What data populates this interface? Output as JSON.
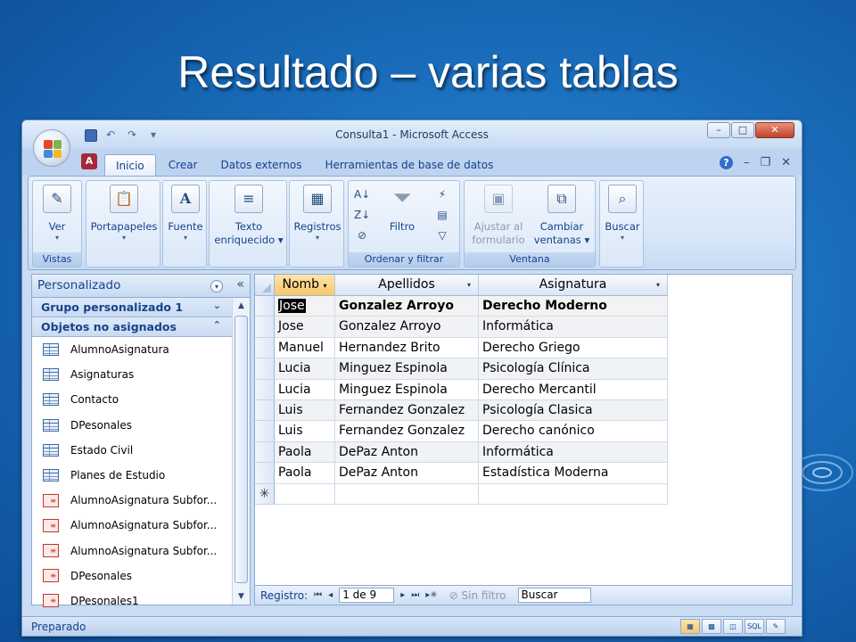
{
  "slide": {
    "title": "Resultado – varias tablas"
  },
  "window": {
    "title": "Consulta1 - Microsoft Access",
    "controls": {
      "minimize": "–",
      "maximize": "□",
      "close": "✕"
    }
  },
  "ribbon": {
    "tabs": [
      "Inicio",
      "Crear",
      "Datos externos",
      "Herramientas de base de datos"
    ],
    "groups": {
      "vistas": {
        "label": "Vistas",
        "ver": "Ver"
      },
      "portapapeles": "Portapapeles",
      "fuente": "Fuente",
      "texto": {
        "line1": "Texto",
        "line2": "enriquecido"
      },
      "registros": "Registros",
      "ordenar": {
        "label": "Ordenar y filtrar",
        "filtro": "Filtro"
      },
      "ventana": {
        "label": "Ventana",
        "ajustar1": "Ajustar al",
        "ajustar2": "formulario",
        "cambiar1": "Cambiar",
        "cambiar2": "ventanas"
      },
      "buscar": "Buscar"
    }
  },
  "nav": {
    "title": "Personalizado",
    "group1": "Grupo personalizado 1",
    "group2": "Objetos no asignados",
    "items": [
      {
        "label": "AlumnoAsignatura",
        "type": "table"
      },
      {
        "label": "Asignaturas",
        "type": "table"
      },
      {
        "label": "Contacto",
        "type": "table"
      },
      {
        "label": "DPesonales",
        "type": "table"
      },
      {
        "label": "Estado Civil",
        "type": "table"
      },
      {
        "label": "Planes de Estudio",
        "type": "table"
      },
      {
        "label": "AlumnoAsignatura Subfor...",
        "type": "form"
      },
      {
        "label": "AlumnoAsignatura Subfor...",
        "type": "form"
      },
      {
        "label": "AlumnoAsignatura Subfor...",
        "type": "form"
      },
      {
        "label": "DPesonales",
        "type": "form"
      },
      {
        "label": "DPesonales1",
        "type": "form"
      }
    ]
  },
  "datasheet": {
    "columns": [
      "Nomb",
      "Apellidos",
      "Asignatura"
    ],
    "rows": [
      [
        "Jose",
        "Gonzalez Arroyo",
        "Derecho Moderno"
      ],
      [
        "Jose",
        "Gonzalez Arroyo",
        "Informática"
      ],
      [
        "Manuel",
        "Hernandez Brito",
        "Derecho Griego"
      ],
      [
        "Lucia",
        "Minguez Espinola",
        "Psicología Clínica"
      ],
      [
        "Lucia",
        "Minguez Espinola",
        "Derecho Mercantil"
      ],
      [
        "Luis",
        "Fernandez Gonzalez",
        "Psicología Clasica"
      ],
      [
        "Luis",
        "Fernandez Gonzalez",
        "Derecho canónico"
      ],
      [
        "Paola",
        "DePaz Anton",
        "Informática"
      ],
      [
        "Paola",
        "DePaz Anton",
        "Estadística Moderna"
      ]
    ],
    "new_row_marker": "✳"
  },
  "record_nav": {
    "label": "Registro:",
    "position": "1 de 9",
    "filter": "Sin filtro",
    "search": "Buscar"
  },
  "status": {
    "text": "Preparado"
  },
  "colors": {
    "accent": "#15428b",
    "selected_header": "#f8c86a",
    "access_red": "#a5283a"
  }
}
